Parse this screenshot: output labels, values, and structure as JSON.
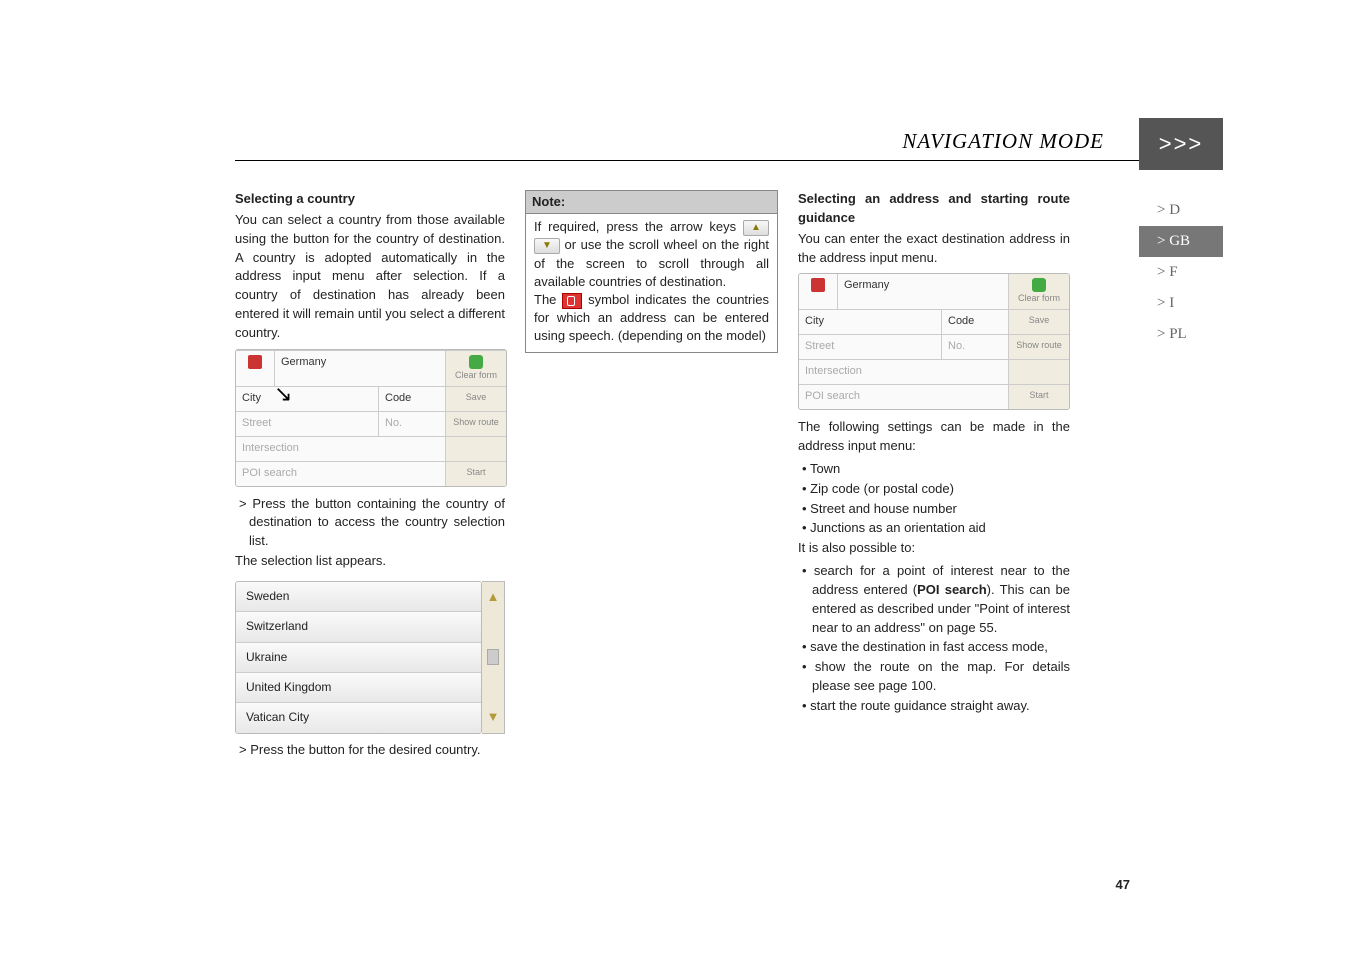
{
  "header": {
    "title": "NAVIGATION MODE",
    "chevrons": ">>>"
  },
  "sideNav": {
    "items": [
      {
        "label": "> D",
        "active": false
      },
      {
        "label": "> GB",
        "active": true
      },
      {
        "label": "> F",
        "active": false
      },
      {
        "label": "> I",
        "active": false
      },
      {
        "label": "> PL",
        "active": false
      }
    ]
  },
  "col1": {
    "heading": "Selecting a country",
    "p1": "You can select a country from those available using the button for the country of destination. A country is adopted automatically in the address input menu after selection. If a country of destination has already been entered it will remain until you select a different country.",
    "fig": {
      "country": "Germany",
      "row_city": "City",
      "row_code": "Code",
      "row_street": "Street",
      "row_no": "No.",
      "row_intersection": "Intersection",
      "row_poi": "POI search",
      "side_clear": "Clear form",
      "side_save": "Save",
      "side_show": "Show route",
      "side_start": "Start"
    },
    "step1a": "Press the button containing the country of destination to access the country selection list.",
    "p2": "The selection list appears.",
    "list": [
      "Sweden",
      "Switzerland",
      "Ukraine",
      "United Kingdom",
      "Vatican City"
    ],
    "step2a": "Press the button for the desired country."
  },
  "col2": {
    "note_title": "Note:",
    "note_p1a": "If required, press the arrow keys",
    "note_p1b": "or use the scroll wheel on the right of the screen to scroll through all available countries of destination.",
    "note_p2a": "The",
    "note_p2b": "symbol indicates the countries for which an address can be entered using speech. (depending on the model)"
  },
  "col3": {
    "heading": "Selecting an address and starting route guidance",
    "p1": "You can enter the exact destination address in the address input menu.",
    "fig": {
      "country": "Germany",
      "row_city": "City",
      "row_code": "Code",
      "row_street": "Street",
      "row_no": "No.",
      "row_intersection": "Intersection",
      "row_poi": "POI search",
      "side_clear": "Clear form",
      "side_save": "Save",
      "side_show": "Show route",
      "side_start": "Start"
    },
    "p2": "The following settings can be made in the address input menu:",
    "bullets1": [
      "Town",
      "Zip code (or postal code)",
      "Street and house number",
      "Junctions as an orientation aid"
    ],
    "p3": "It is also possible to:",
    "b2_0a": "search for a point of interest near to the address entered (",
    "b2_0bold": "POI search",
    "b2_0b": "). This can be entered as described under \"Point of interest near to an address\" on page 55.",
    "bullets2_rest": [
      "save the destination in fast access mode,",
      "show the route on the map. For details please see page 100.",
      "start the route guidance straight away."
    ]
  },
  "pageNumber": "47"
}
